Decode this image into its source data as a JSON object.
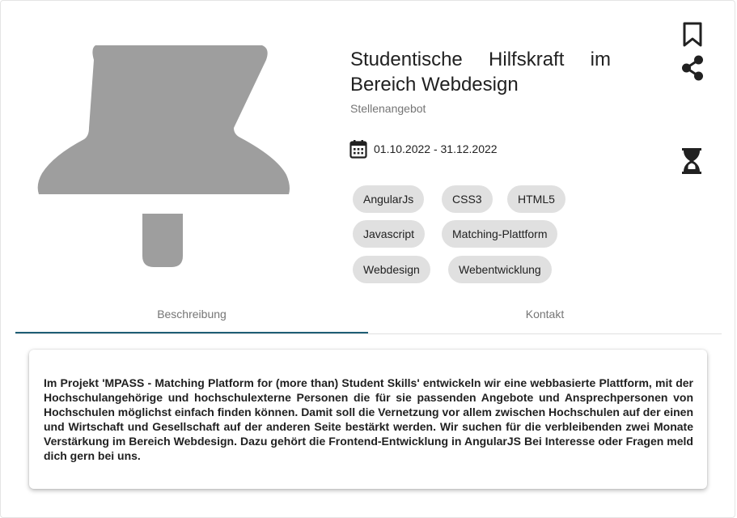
{
  "listing": {
    "title": "Studentische Hilfskraft im Bereich Webdesign",
    "type": "Stellenangebot",
    "date_range": "01.10.2022 - 31.12.2022"
  },
  "icons": {
    "image": "pushpin-placeholder-icon",
    "bookmark": "bookmark-icon",
    "share": "share-icon",
    "status": "hourglass-icon",
    "date": "calendar-icon"
  },
  "tags": [
    "AngularJs",
    "CSS3",
    "HTML5",
    "Javascript",
    "Matching-Plattform",
    "Webdesign",
    "Webentwicklung"
  ],
  "tabs": [
    {
      "label": "Beschreibung",
      "active": true
    },
    {
      "label": "Kontakt",
      "active": false
    }
  ],
  "description": "Im Projekt 'MPASS - Matching Platform for (more than) Student Skills' entwickeln wir eine webbasierte Plattform, mit der Hochschulangehörige und hochschulexterne Personen die für sie passenden Angebote und Ansprechpersonen von Hochschulen möglichst einfach finden können. Damit soll die Vernetzung vor allem zwischen Hochschulen auf der einen und Wirtschaft und Gesellschaft auf der anderen Seite bestärkt werden. Wir suchen für die verbleibenden zwei Monate Verstärkung im Bereich Webdesign. Dazu gehört die Frontend-Entwicklung in AngularJS Bei Interesse oder Fragen meld dich gern bei uns.",
  "colors": {
    "placeholder_gray": "#9e9e9e",
    "chip_bg": "#e0e0e0",
    "tab_indicator": "#1f5e75",
    "text": "#212121",
    "muted": "#757575"
  }
}
